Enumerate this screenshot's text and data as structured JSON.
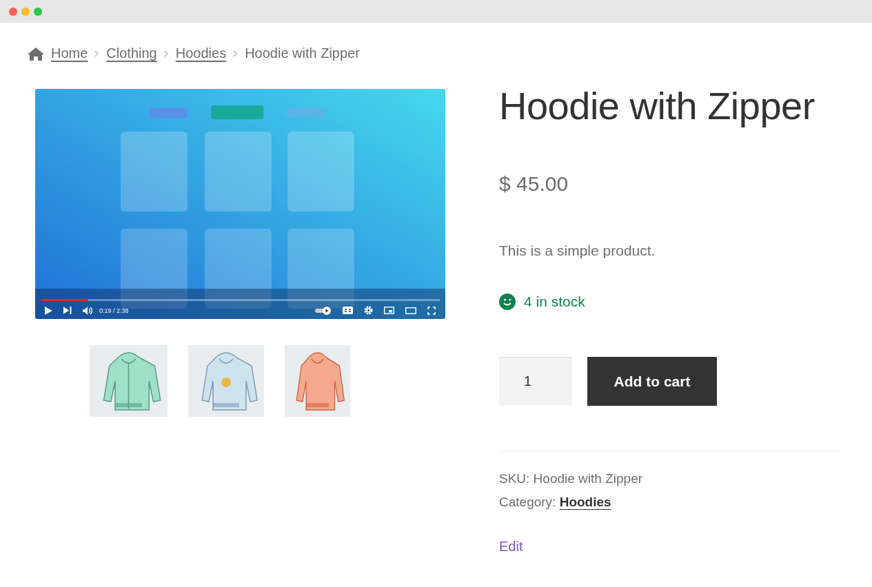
{
  "window": {
    "controls": [
      {
        "color": "#ff5f57"
      },
      {
        "color": "#febc2e"
      },
      {
        "color": "#28c840"
      }
    ]
  },
  "breadcrumb": [
    {
      "label": "Home",
      "link": true
    },
    {
      "label": "Clothing",
      "link": true
    },
    {
      "label": "Hoodies",
      "link": true
    },
    {
      "label": "Hoodie with Zipper",
      "link": false
    }
  ],
  "video": {
    "kind": "picture",
    "progress": {
      "level": 0.12
    },
    "time": "0:19 / 2:38"
  },
  "product": {
    "title": "Hoodie with Zipper",
    "price": "$ 45.00",
    "description": "This is a simple product.",
    "stock": "4 in stock",
    "quantity": "1",
    "add_to_cart": "Add to cart",
    "sku": "SKU: Hoodie with Zipper",
    "category_label": "Category:",
    "category_link": "Hoodies",
    "edit": "Edit"
  }
}
